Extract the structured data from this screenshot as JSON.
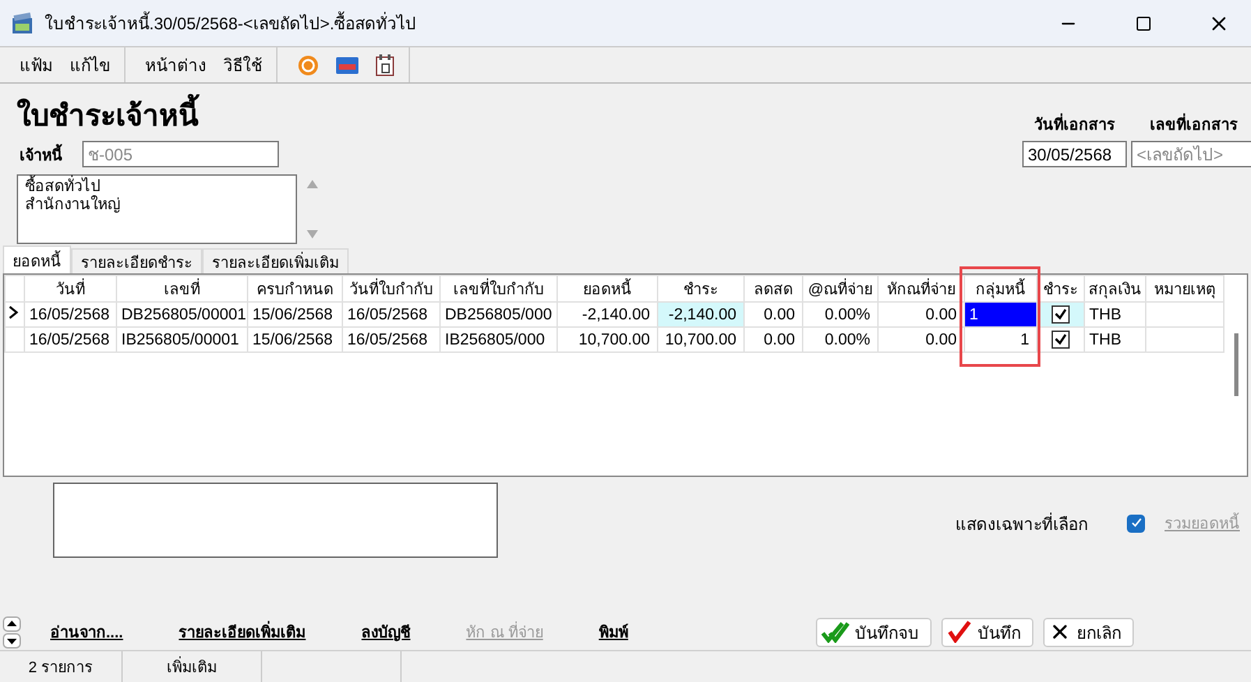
{
  "window": {
    "title": "ใบชำระเจ้าหนี้.30/05/2568-<เลขถัดไป>.ซื้อสดทั่วไป"
  },
  "menu_groups": [
    [
      "แฟ้ม",
      "แก้ไข"
    ],
    [
      "หน้าต่าง",
      "วิธีใช้"
    ]
  ],
  "form": {
    "heading": "ใบชำระเจ้าหนี้",
    "creditor_label": "เจ้าหนี้",
    "creditor_value": "ช-005",
    "address_lines": [
      "ซื้อสดทั่วไป",
      "สำนักงานใหญ่"
    ],
    "doc_date_label": "วันที่เอกสาร",
    "doc_date_value": "30/05/2568",
    "doc_no_label": "เลขที่เอกสาร",
    "doc_no_placeholder": "<เลขถัดไป>"
  },
  "tabs": [
    {
      "label": "ยอดหนี้",
      "selected": true
    },
    {
      "label": "รายละเอียดชำระ",
      "selected": false
    },
    {
      "label": "รายละเอียดเพิ่มเติม",
      "selected": false
    }
  ],
  "table": {
    "columns": [
      {
        "label": "วันที่",
        "highlighted": false
      },
      {
        "label": "เลขที่",
        "highlighted": false
      },
      {
        "label": "ครบกำหนด",
        "highlighted": false
      },
      {
        "label": "วันที่ใบกำกับ",
        "highlighted": false
      },
      {
        "label": "เลขที่ใบกำกับ",
        "highlighted": false
      },
      {
        "label": "ยอดหนี้",
        "highlighted": false
      },
      {
        "label": "ชำระ",
        "highlighted": false
      },
      {
        "label": "ลดสด",
        "highlighted": false
      },
      {
        "label": "@ณที่จ่าย",
        "highlighted": false
      },
      {
        "label": "หักณที่จ่าย",
        "highlighted": false
      },
      {
        "label": "กลุ่มหนี้",
        "highlighted": true
      },
      {
        "label": "ชำระ",
        "highlighted": false
      },
      {
        "label": "สกุลเงิน",
        "highlighted": false
      },
      {
        "label": "หมายเหตุ",
        "highlighted": false
      }
    ],
    "rows": [
      {
        "selected": true,
        "cells": [
          "16/05/2568",
          "DB256805/00001",
          "15/06/2568",
          "16/05/2568",
          "DB256805/000",
          "-2,140.00",
          "-2,140.00",
          "0.00",
          "0.00%",
          "0.00",
          "1"
        ],
        "paid": true,
        "currency": "THB"
      },
      {
        "selected": false,
        "cells": [
          "16/05/2568",
          "IB256805/00001",
          "15/06/2568",
          "16/05/2568",
          "IB256805/000",
          "10,700.00",
          "10,700.00",
          "0.00",
          "0.00%",
          "0.00",
          "1"
        ],
        "paid": true,
        "currency": "THB"
      }
    ]
  },
  "show_selected": {
    "label": "แสดงเฉพาะที่เลือก",
    "checked": true
  },
  "total_link": {
    "label": "รวมยอดหนี้",
    "disabled": true
  },
  "actions": [
    {
      "label": "อ่านจาก....",
      "disabled": false
    },
    {
      "label": "รายละเอียดเพิ่มเติม",
      "disabled": false
    },
    {
      "label": "ลงบัญชี",
      "disabled": false
    },
    {
      "label": "หัก ณ ที่จ่าย",
      "disabled": true
    },
    {
      "label": "พิมพ์",
      "disabled": false
    }
  ],
  "buttons": [
    {
      "label": "บันทึกจบ",
      "kind": "save_close"
    },
    {
      "label": "บันทึก",
      "kind": "save"
    },
    {
      "label": "ยกเลิก",
      "kind": "cancel"
    }
  ],
  "status_bar": [
    "2 รายการ",
    "เพิ่มเติม"
  ]
}
